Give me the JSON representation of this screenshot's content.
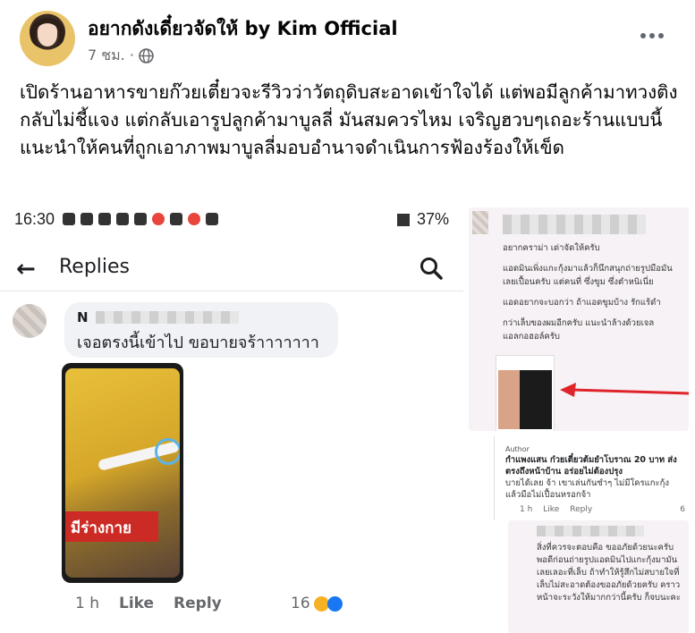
{
  "post": {
    "author": "อยากดังเดี๋ยวจัดให้ by Kim Official",
    "time": "7 ชม. ·",
    "text": "เปิดร้านอาหารขายก๊วยเตี๋ยวจะรีวิวว่าวัตถุดิบสะอาดเข้าใจได้ แต่พอมีลูกค้ามาทวงติงกลับไม่ชี้แจง แต่กลับเอารูปลูกค้ามาบูลลี่ มันสมควรไหม เจริญฮวบๆเถอะร้านแบบนี้ แนะนำให้คนที่ถูกเอาภาพมาบูลลี่มอบอำนาจดำเนินการฟ้องร้องให้เข็ด"
  },
  "left_shot": {
    "status_time": "16:30",
    "status_battery": "37%",
    "header_title": "Replies",
    "comment": {
      "author_prefix": "N",
      "text": "เจอตรงนี้เข้าไป  ขอบายจร้าาาาาาา",
      "video_banner": "มีร่างกาย",
      "timestamp": "1 h",
      "like": "Like",
      "reply": "Reply",
      "reaction_count": "16"
    }
  },
  "right_top": {
    "lines": [
      "อยากคราม่า เด่าจัดให้ครับ",
      "แอดมินเพิ่งแกะกุ้งมาแล้วก็นึกสนุกถ่ายรูปมือมัน เลยเปื้อนครับ แต่คนที่ ซึ่งขูม ซึ่งตำหนิเนี่ย",
      "แอดอยากจะบอกว่า ถ้าแอดขูมบ้าง รักแร้ดำ",
      "กว่าเล็บของผมอีกครับ แนะนำล้างด้วยเจล แอลกอฮอล์ครับ"
    ]
  },
  "right_mid": {
    "author_badge": "Author",
    "title": "กำแพงแสน ก๋วยเตี๋ยวต้มยำโบราณ 20 บาท ส่งตรงถึงหน้าบ้าน อร่อยไม่ต้องปรุง",
    "text": "บายได้เลย จ้า เขาเล่นกันซำๆ ไม่มีใครแกะกุ้งแล้วมือไม่เปื้อนหรอกจ้า",
    "timestamp": "1 h",
    "like": "Like",
    "reply": "Reply",
    "reaction_count": "6"
  },
  "right_bot": {
    "text": "สิ่งที่ควรจะตอบคือ ขออภัยด้วยนะครับ พอดีก่อนถ่ายรูปแอดมินไปแกะกุ้งมามัน เลยเลอะที่เล็บ ถ้าทำให้รู้สึกไม่สบายใจที่เล็บไม่สะอาดต้องขออภัยด้วยครับ คราวหน้าจะระวังให้มากกว่านี้ครับ ก็จบนะคะ"
  },
  "icons": {
    "globe": "globe-icon",
    "more": "more-options-icon",
    "back": "back-arrow-icon",
    "search": "search-icon"
  },
  "colors": {
    "text": "#050505",
    "meta": "#65676b",
    "arrow": "#e0242b",
    "banner": "#cc2a24"
  }
}
